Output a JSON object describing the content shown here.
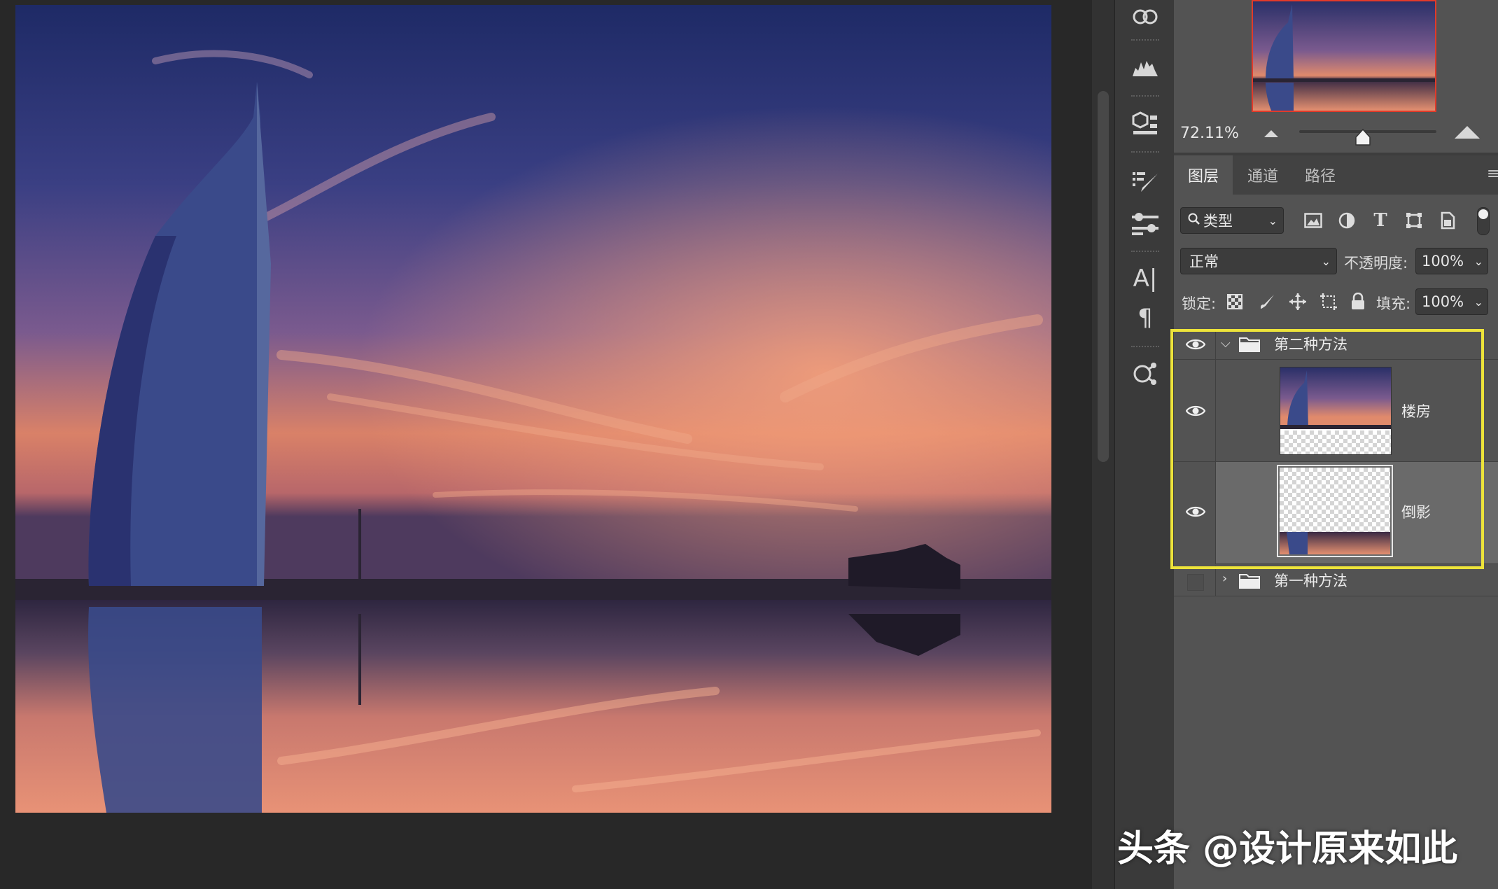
{
  "navigator": {
    "zoom_value": "72.11%"
  },
  "tool_strip": {
    "icons": [
      "libraries-icon",
      "histogram-icon",
      "3d-icon",
      "brush-settings-icon",
      "properties-icon",
      "character-icon",
      "paragraph-icon",
      "glyph-share-icon"
    ]
  },
  "tabs": {
    "layers": "图层",
    "channels": "通道",
    "paths": "路径"
  },
  "filter": {
    "kind_label": "类型"
  },
  "blend": {
    "mode": "正常",
    "opacity_label": "不透明度:",
    "opacity_value": "100%",
    "lock_label": "锁定:",
    "fill_label": "填充:",
    "fill_value": "100%"
  },
  "layers": [
    {
      "name": "第二种方法",
      "type": "group",
      "expanded": true,
      "visible": true
    },
    {
      "name": "楼房",
      "type": "layer",
      "visible": true
    },
    {
      "name": "倒影",
      "type": "layer",
      "visible": true,
      "selected": true
    },
    {
      "name": "第一种方法",
      "type": "group",
      "expanded": false,
      "visible": false
    }
  ],
  "watermark": "头条 @设计原来如此",
  "colors": {
    "highlight": "#ede33a",
    "navigator_frame": "#e23a2a",
    "panel_bg": "#535353"
  }
}
